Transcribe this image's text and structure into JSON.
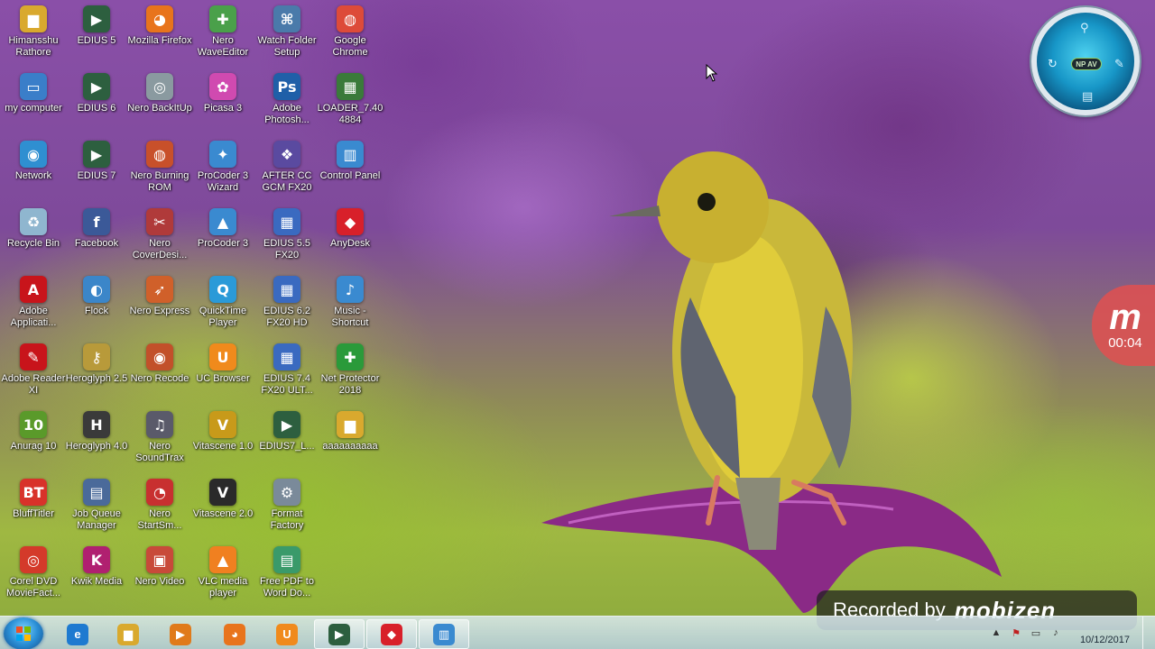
{
  "desktop": {
    "icons": [
      {
        "label": "Himansshu Rathore",
        "icon": "folder-icon",
        "color": "#d9a92e",
        "glyph": "▆"
      },
      {
        "label": "my computer",
        "icon": "computer-icon",
        "color": "#3a7ec9",
        "glyph": "▭"
      },
      {
        "label": "Network",
        "icon": "network-icon",
        "color": "#2f8fd1",
        "glyph": "◉"
      },
      {
        "label": "Recycle Bin",
        "icon": "recycle-bin-icon",
        "color": "#8fb6cf",
        "glyph": "♻"
      },
      {
        "label": "Adobe Applicati...",
        "icon": "adobe-icon",
        "color": "#c8141b",
        "glyph": "A"
      },
      {
        "label": "Adobe Reader XI",
        "icon": "adobe-reader-icon",
        "color": "#c8141b",
        "glyph": "✎"
      },
      {
        "label": "Anurag 10",
        "icon": "anurag-icon",
        "color": "#5a9a2a",
        "glyph": "10"
      },
      {
        "label": "BluffTitler",
        "icon": "blufftitler-icon",
        "color": "#d8322a",
        "glyph": "BT"
      },
      {
        "label": "Corel DVD MovieFact...",
        "icon": "corel-icon",
        "color": "#d43a2a",
        "glyph": "◎"
      },
      {
        "label": "EDIUS 5",
        "icon": "edius-icon",
        "color": "#2d5f3f",
        "glyph": "▶"
      },
      {
        "label": "EDIUS 6",
        "icon": "edius-icon",
        "color": "#2d5f3f",
        "glyph": "▶"
      },
      {
        "label": "EDIUS 7",
        "icon": "edius-icon",
        "color": "#2d5f3f",
        "glyph": "▶"
      },
      {
        "label": "Facebook",
        "icon": "facebook-icon",
        "color": "#3b5998",
        "glyph": "f"
      },
      {
        "label": "Flock",
        "icon": "flock-icon",
        "color": "#3b86c9",
        "glyph": "◐"
      },
      {
        "label": "Heroglyph 2.5",
        "icon": "heroglyph-icon",
        "color": "#b89a3a",
        "glyph": "⚷"
      },
      {
        "label": "Heroglyph 4.0",
        "icon": "heroglyph-icon",
        "color": "#3a3a3a",
        "glyph": "H"
      },
      {
        "label": "Job Queue Manager",
        "icon": "job-queue-icon",
        "color": "#4a6a9a",
        "glyph": "▤"
      },
      {
        "label": "Kwik Media",
        "icon": "kwik-media-icon",
        "color": "#b02070",
        "glyph": "K"
      },
      {
        "label": "Mozilla Firefox",
        "icon": "firefox-icon",
        "color": "#e8741c",
        "glyph": "◕"
      },
      {
        "label": "Nero BackItUp",
        "icon": "nero-icon",
        "color": "#8a9aa0",
        "glyph": "◎"
      },
      {
        "label": "Nero Burning ROM",
        "icon": "nero-icon",
        "color": "#c8502a",
        "glyph": "◍"
      },
      {
        "label": "Nero CoverDesi...",
        "icon": "nero-icon",
        "color": "#b03a3a",
        "glyph": "✂"
      },
      {
        "label": "Nero Express",
        "icon": "nero-icon",
        "color": "#d0602a",
        "glyph": "➶"
      },
      {
        "label": "Nero Recode",
        "icon": "nero-icon",
        "color": "#c2502a",
        "glyph": "◉"
      },
      {
        "label": "Nero SoundTrax",
        "icon": "nero-icon",
        "color": "#5a5a6a",
        "glyph": "♫"
      },
      {
        "label": "Nero StartSm...",
        "icon": "nero-icon",
        "color": "#c83030",
        "glyph": "◔"
      },
      {
        "label": "Nero Video",
        "icon": "nero-icon",
        "color": "#c84a3a",
        "glyph": "▣"
      },
      {
        "label": "Nero WaveEditor",
        "icon": "nero-icon",
        "color": "#4aa04a",
        "glyph": "✚"
      },
      {
        "label": "Picasa 3",
        "icon": "picasa-icon",
        "color": "#d04ab0",
        "glyph": "✿"
      },
      {
        "label": "ProCoder 3 Wizard",
        "icon": "procoder-icon",
        "color": "#3a8ad0",
        "glyph": "✦"
      },
      {
        "label": "ProCoder 3",
        "icon": "procoder-icon",
        "color": "#3a8ad0",
        "glyph": "▲"
      },
      {
        "label": "QuickTime Player",
        "icon": "quicktime-icon",
        "color": "#2a9ad8",
        "glyph": "Q"
      },
      {
        "label": "UC Browser",
        "icon": "uc-browser-icon",
        "color": "#f08a1c",
        "glyph": "U"
      },
      {
        "label": "Vitascene 1.0",
        "icon": "vitascene-icon",
        "color": "#c89a1a",
        "glyph": "V"
      },
      {
        "label": "Vitascene 2.0",
        "icon": "vitascene-icon",
        "color": "#2a2a2a",
        "glyph": "V"
      },
      {
        "label": "VLC media player",
        "icon": "vlc-icon",
        "color": "#f08020",
        "glyph": "▲"
      },
      {
        "label": "Watch Folder Setup",
        "icon": "watch-folder-icon",
        "color": "#4a7aaa",
        "glyph": "⌘"
      },
      {
        "label": "Adobe Photosh...",
        "icon": "photoshop-icon",
        "color": "#1f5fa8",
        "glyph": "Ps"
      },
      {
        "label": "AFTER CC GCM FX20",
        "icon": "after-effects-icon",
        "color": "#5a4aa0",
        "glyph": "❖"
      },
      {
        "label": "EDIUS 5.5 FX20",
        "icon": "edius-icon",
        "color": "#3a6ac0",
        "glyph": "▦"
      },
      {
        "label": "EDIUS 6.2 FX20 HD",
        "icon": "edius-icon",
        "color": "#3a6ac0",
        "glyph": "▦"
      },
      {
        "label": "EDIUS 7.4 FX20 ULT...",
        "icon": "edius-icon",
        "color": "#3a6ac0",
        "glyph": "▦"
      },
      {
        "label": "EDIUS7_L...",
        "icon": "edius-icon",
        "color": "#2d5f3f",
        "glyph": "▶"
      },
      {
        "label": "Format Factory",
        "icon": "format-factory-icon",
        "color": "#7a8a9a",
        "glyph": "⚙"
      },
      {
        "label": "Free PDF to Word Do...",
        "icon": "pdf-to-word-icon",
        "color": "#3a9a6a",
        "glyph": "▤"
      },
      {
        "label": "Google Chrome",
        "icon": "chrome-icon",
        "color": "#dd4b39",
        "glyph": "◍"
      },
      {
        "label": "LOADER_7.40 4884",
        "icon": "loader-icon",
        "color": "#3a7a3a",
        "glyph": "▦"
      },
      {
        "label": "Control Panel",
        "icon": "control-panel-icon",
        "color": "#3a8ad0",
        "glyph": "▥"
      },
      {
        "label": "AnyDesk",
        "icon": "anydesk-icon",
        "color": "#d8202a",
        "glyph": "◆"
      },
      {
        "label": "Music - Shortcut",
        "icon": "music-icon",
        "color": "#3a8ad0",
        "glyph": "♪"
      },
      {
        "label": "Net Protector 2018",
        "icon": "net-protector-icon",
        "color": "#2a9a3a",
        "glyph": "✚"
      },
      {
        "label": "aaaaaaaaaa",
        "icon": "folder-icon",
        "color": "#d9a92e",
        "glyph": "▆"
      }
    ]
  },
  "gadget": {
    "badge": "NP AV"
  },
  "recorder": {
    "logo": "m",
    "time": "00:04",
    "watermark_text": "Recorded by",
    "watermark_brand": "mobizen"
  },
  "taskbar": {
    "buttons": [
      {
        "name": "internet-explorer-icon",
        "color": "#1e7ad0",
        "glyph": "e"
      },
      {
        "name": "file-explorer-icon",
        "color": "#d9a92e",
        "glyph": "▆"
      },
      {
        "name": "media-player-icon",
        "color": "#e07a1a",
        "glyph": "▶"
      },
      {
        "name": "firefox-icon",
        "color": "#e8741c",
        "glyph": "◕"
      },
      {
        "name": "uc-browser-icon",
        "color": "#f08a1c",
        "glyph": "U"
      },
      {
        "name": "edius-icon",
        "color": "#2d5f3f",
        "glyph": "▶"
      },
      {
        "name": "anydesk-icon",
        "color": "#d8202a",
        "glyph": "◆"
      },
      {
        "name": "control-panel-icon",
        "color": "#3a8ad0",
        "glyph": "▥"
      }
    ],
    "date": "10/12/2017"
  }
}
